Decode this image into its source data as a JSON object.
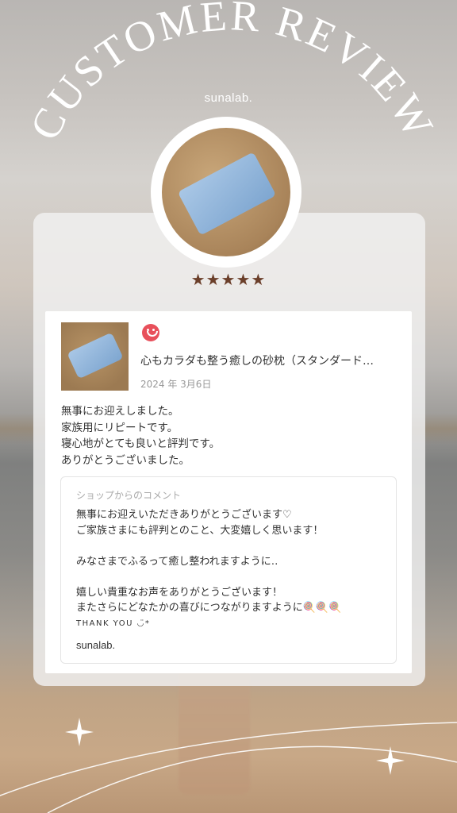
{
  "header": {
    "title": "CUSTOMER REVIEW",
    "brand": "sunalab."
  },
  "rating": {
    "stars": "★★★★★",
    "value": 5,
    "max": 5
  },
  "review": {
    "reaction_icon": "smile-icon",
    "product_name": "心もカラダも整う癒しの砂枕（スタンダード…",
    "date": "2024 年 3月6日",
    "body_lines": [
      "無事にお迎えしました。",
      "家族用にリピートです。",
      "寝心地がとても良いと評判です。",
      "ありがとうございました。"
    ]
  },
  "shop_comment": {
    "label": "ショップからのコメント",
    "lines": [
      "無事にお迎えいただきありがとうございます♡",
      "ご家族さまにも評判とのこと、大変嬉しく思います！",
      "",
      "みなさまでふるって癒し整われますように‥",
      "",
      "嬉しい貴重なお声をありがとうございます！",
      "またさらにどなたかの喜びにつながりますように🍭🍭🍭"
    ],
    "thanks": "THANK YOU ◡̈*",
    "signature": "sunalab."
  },
  "colors": {
    "star": "#6b3f2a",
    "smile": "#e8505b",
    "pillow": "#8fb3d9"
  }
}
